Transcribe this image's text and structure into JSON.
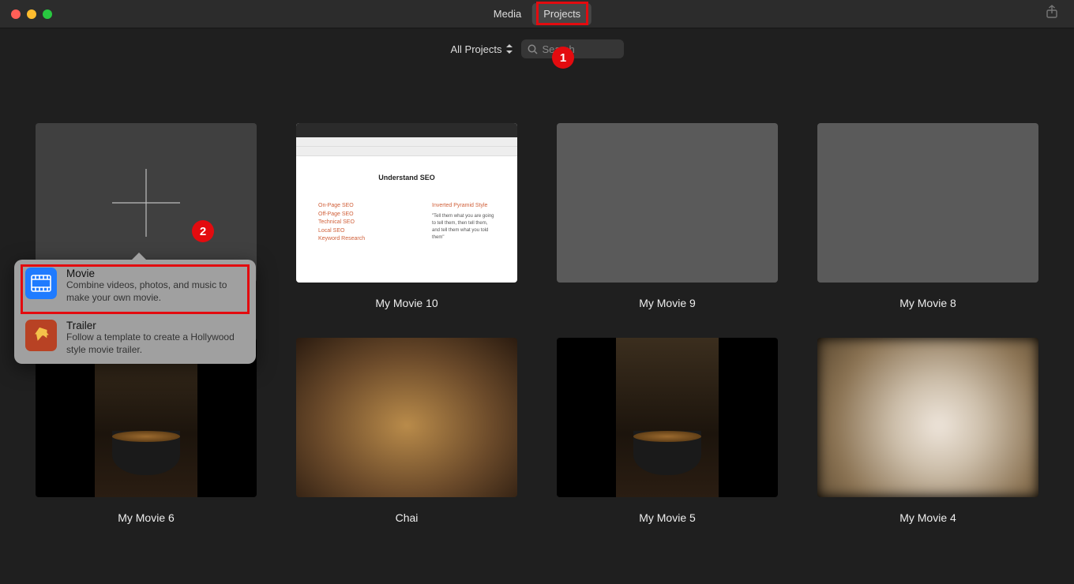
{
  "header": {
    "tabs": [
      {
        "id": "media",
        "label": "Media",
        "active": false
      },
      {
        "id": "projects",
        "label": "Projects",
        "active": true
      }
    ]
  },
  "toolbar": {
    "filter_label": "All Projects",
    "search_placeholder": "Search"
  },
  "create_new": {
    "name": "Create New"
  },
  "popover": {
    "items": [
      {
        "id": "movie",
        "title": "Movie",
        "desc": "Combine videos, photos, and music to make your own movie."
      },
      {
        "id": "trailer",
        "title": "Trailer",
        "desc": "Follow a template to create a Hollywood style movie trailer."
      }
    ]
  },
  "projects": [
    {
      "id": "p10",
      "title": "My Movie 10",
      "thumb": "doc"
    },
    {
      "id": "p9",
      "title": "My Movie 9",
      "thumb": "blank"
    },
    {
      "id": "p8",
      "title": "My Movie 8",
      "thumb": "blank"
    },
    {
      "id": "p6",
      "title": "My Movie 6",
      "thumb": "mov6"
    },
    {
      "id": "pchai",
      "title": "Chai",
      "thumb": "chai"
    },
    {
      "id": "p5",
      "title": "My Movie 5",
      "thumb": "mov5"
    },
    {
      "id": "p4",
      "title": "My Movie 4",
      "thumb": "mov4"
    }
  ],
  "doc_thumb": {
    "heading": "Understand SEO",
    "left_lines": [
      "On-Page SEO",
      "Off-Page SEO",
      "Technical SEO",
      "Local SEO",
      "",
      "Keyword Research"
    ],
    "right_top": "Inverted Pyramid Style",
    "right_body": "\"Tell them what you are going to tell them, then tell them, and tell them what you told them\""
  },
  "annotations": {
    "circle1": "1",
    "circle2": "2"
  }
}
